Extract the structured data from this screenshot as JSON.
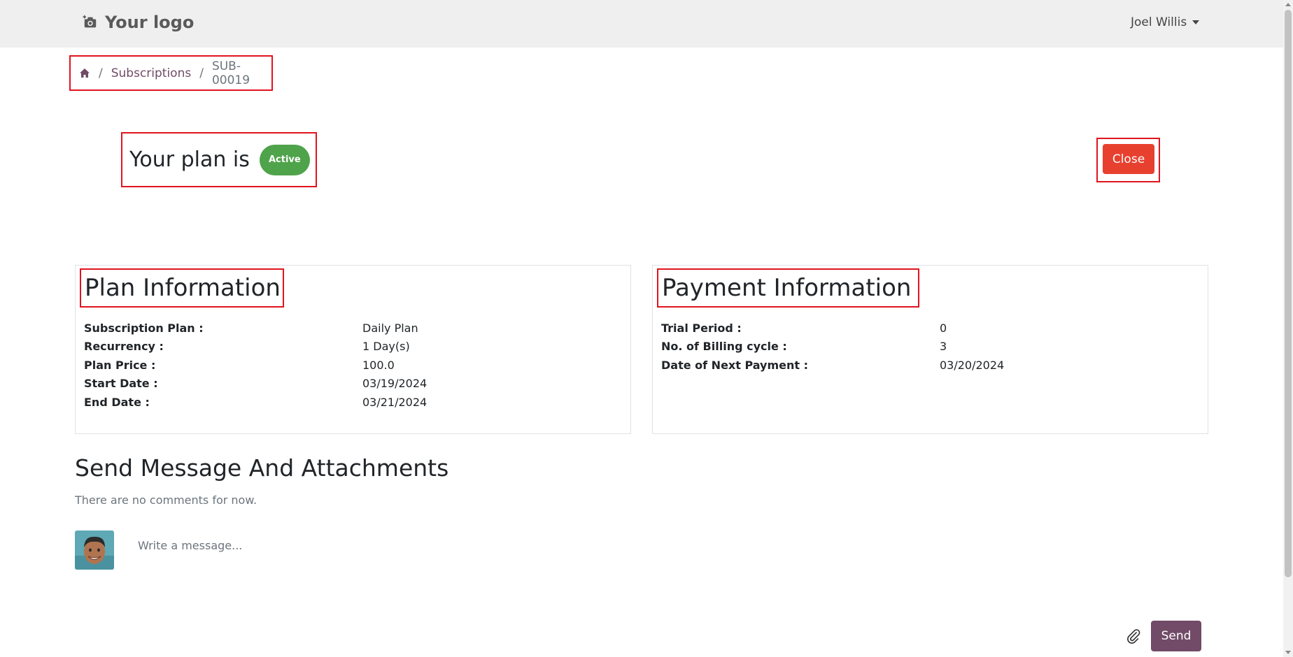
{
  "header": {
    "logo_text": "Your logo",
    "logo_icon": "camera-plus-icon",
    "user_name": "Joel Willis"
  },
  "breadcrumb": {
    "home_icon": "home-icon",
    "items": [
      "Subscriptions",
      "SUB-00019"
    ]
  },
  "plan": {
    "status_text": "Your plan is",
    "status_badge": "Active",
    "close_label": "Close"
  },
  "plan_information": {
    "title": "Plan Information",
    "rows": [
      {
        "label": "Subscription Plan :",
        "value": "Daily Plan"
      },
      {
        "label": "Recurrency :",
        "value": "1 Day(s)"
      },
      {
        "label": "Plan Price :",
        "value": "100.0"
      },
      {
        "label": "Start Date :",
        "value": "03/19/2024"
      },
      {
        "label": "End Date :",
        "value": "03/21/2024"
      }
    ]
  },
  "payment_information": {
    "title": "Payment Information",
    "rows": [
      {
        "label": "Trial Period :",
        "value": "0"
      },
      {
        "label": "No. of Billing cycle :",
        "value": "3"
      },
      {
        "label": "Date of Next Payment :",
        "value": "03/20/2024"
      }
    ]
  },
  "messages": {
    "title": "Send Message And Attachments",
    "empty_text": "There are no comments for now.",
    "placeholder": "Write a message...",
    "send_label": "Send",
    "attach_icon": "paperclip-icon"
  },
  "colors": {
    "accent": "#714b67",
    "badge": "#4fa34a",
    "close_button": "#e8402f",
    "highlight_border": "#e0141e"
  }
}
